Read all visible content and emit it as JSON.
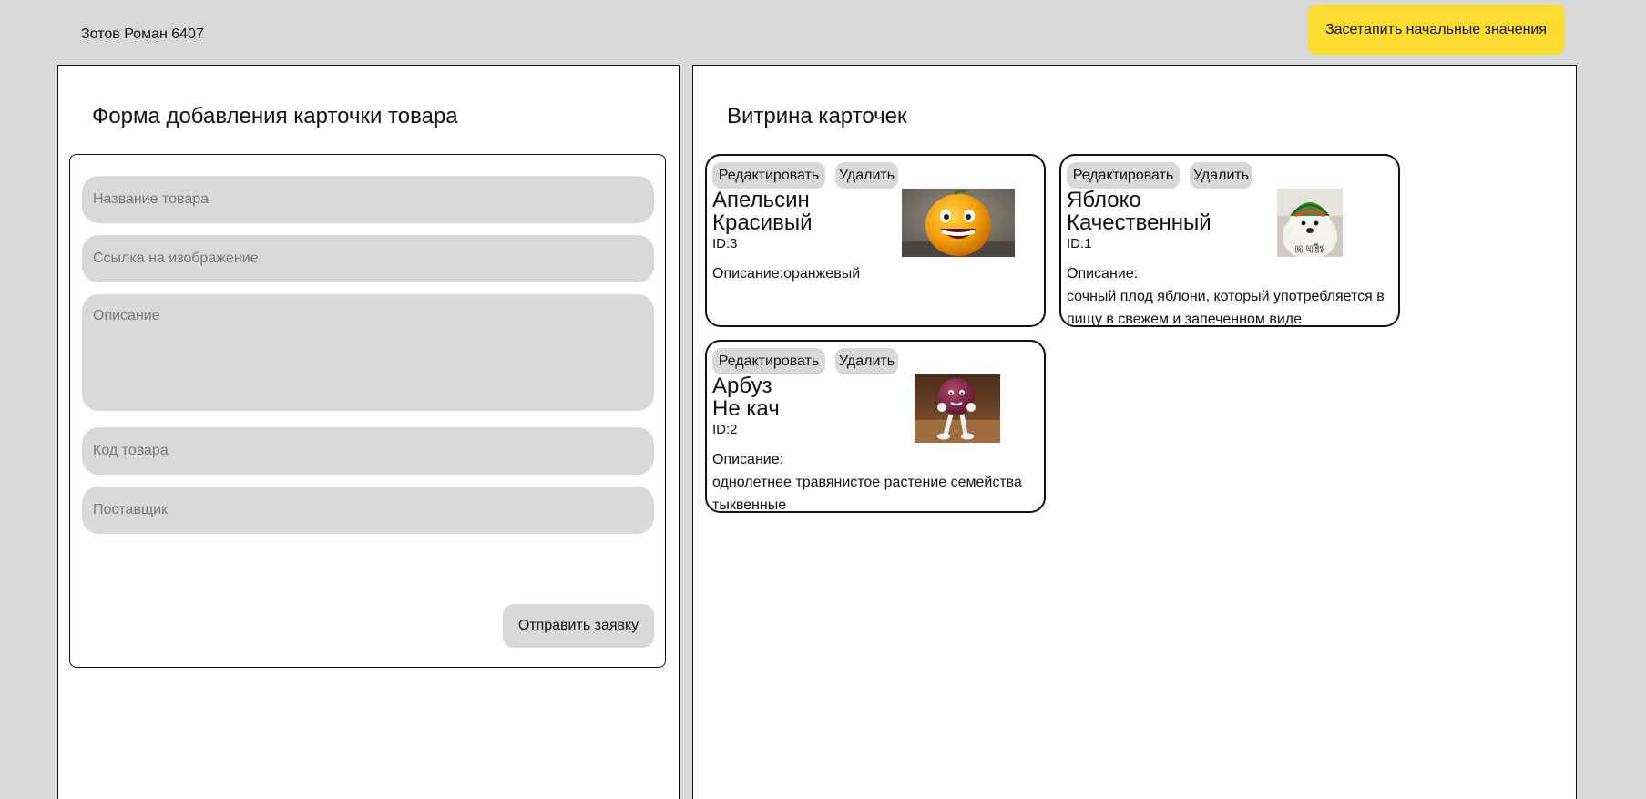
{
  "header": {
    "author": "Зотов Роман 6407",
    "reset_label": "Засетапить начальные значения",
    "accent_color": "#fcdc2e"
  },
  "form": {
    "title": "Форма добавления карточки товара",
    "name_placeholder": "Название товара",
    "image_placeholder": "Ссылка на изображение",
    "description_placeholder": "Описание",
    "code_placeholder": "Код товара",
    "supplier_placeholder": "Поставщик",
    "submit_label": "Отправить заявку"
  },
  "showcase": {
    "title": "Витрина карточек",
    "cards": [
      {
        "edit_label": "Редактировать",
        "delete_label": "Удалить",
        "name_line1": "Апельсин",
        "name_line2": "Красивый",
        "id_text": "ID:3",
        "description_label": "Описание:",
        "description": "оранжевый",
        "image_icon": "orange-meme-image"
      },
      {
        "edit_label": "Редактировать",
        "delete_label": "Удалить",
        "name_line1": "Яблоко",
        "name_line2": "Качественный",
        "id_text": "ID:1",
        "description_label": "Описание:",
        "description": "сочный плод яблони, который употребляется в пищу в свежем и запеченном виде",
        "image_caption": "И ЧЁ?",
        "image_icon": "dog-watermelon-meme-image"
      },
      {
        "edit_label": "Редактировать",
        "delete_label": "Удалить",
        "name_line1": "Арбуз",
        "name_line2": "Не кач",
        "id_text": "ID:2",
        "description_label": "Описание:",
        "description": "однолетнее травянистое растение семейства тыквенные",
        "image_icon": "plum-character-image"
      }
    ]
  }
}
